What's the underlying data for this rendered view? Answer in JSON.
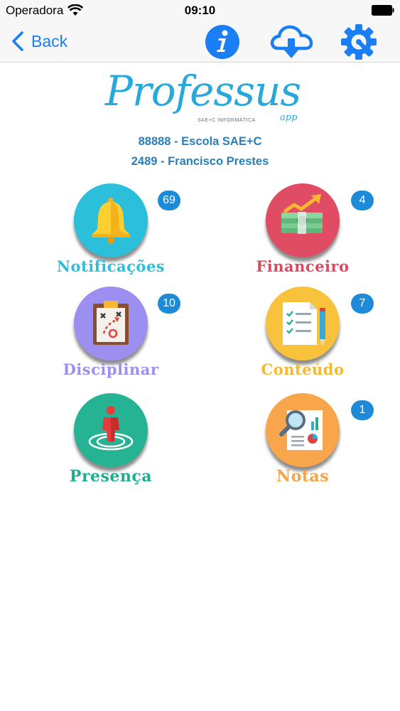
{
  "status_bar": {
    "carrier": "Operadora",
    "time": "09:10"
  },
  "nav": {
    "back_label": "Back",
    "icons": [
      "info-icon",
      "cloud-download-icon",
      "settings-gear-icon"
    ]
  },
  "header": {
    "logo_text": "Professus",
    "logo_subtitle": "SAE+C INFORMÁTICA",
    "logo_suffix": "app",
    "school": "88888 - Escola SAE+C",
    "student": "2489 - Francisco Prestes"
  },
  "menu": [
    {
      "label": "Notificações",
      "badge": "69",
      "color": "#2bbfdc",
      "label_color": "#2bbfdc",
      "icon": "bell-icon"
    },
    {
      "label": "Financeiro",
      "badge": "4",
      "color": "#e04c63",
      "label_color": "#d94a60",
      "icon": "money-growth-icon"
    },
    {
      "label": "Disciplinar",
      "badge": "10",
      "color": "#9d8ff0",
      "label_color": "#9d8ff0",
      "icon": "clipboard-strategy-icon"
    },
    {
      "label": "Conteúdo",
      "badge": "7",
      "color": "#f9c23c",
      "label_color": "#f4b92c",
      "icon": "checklist-pen-icon"
    },
    {
      "label": "Presença",
      "badge": "",
      "color": "#26b394",
      "label_color": "#1fae8e",
      "icon": "person-target-icon"
    },
    {
      "label": "Notas",
      "badge": "1",
      "color": "#f8a54b",
      "label_color": "#f7a449",
      "icon": "report-magnifier-icon"
    }
  ],
  "colors": {
    "accent": "#1a7ff5",
    "badge": "#1d8bd8",
    "header_text": "#2a7fb8"
  }
}
